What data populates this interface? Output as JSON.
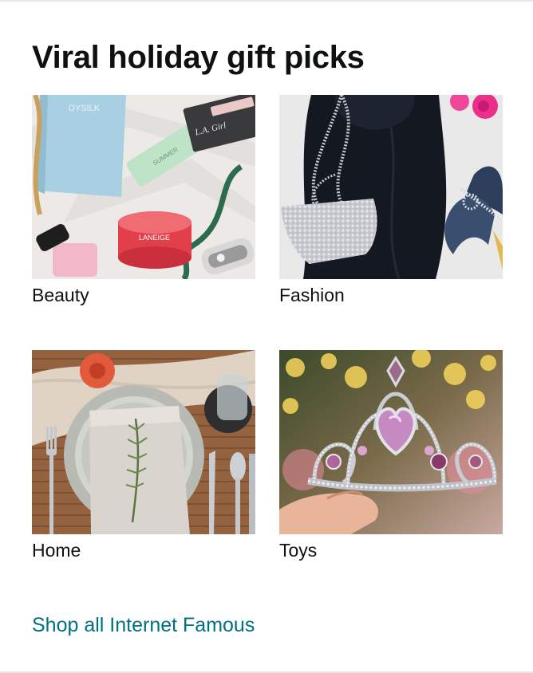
{
  "card": {
    "title": "Viral holiday gift picks",
    "tiles": [
      {
        "label": "Beauty",
        "image": "beauty-products-photo"
      },
      {
        "label": "Fashion",
        "image": "black-dress-rhinestone-bag-photo"
      },
      {
        "label": "Home",
        "image": "table-place-setting-photo"
      },
      {
        "label": "Toys",
        "image": "princess-tiara-photo"
      }
    ],
    "product_print": {
      "brand_1": "DYSILK",
      "brand_2": "LANEIGE",
      "brand_3": "L.A. Girl"
    },
    "link": "Shop all Internet Famous"
  },
  "colors": {
    "link": "#007185",
    "text": "#0f1111"
  }
}
